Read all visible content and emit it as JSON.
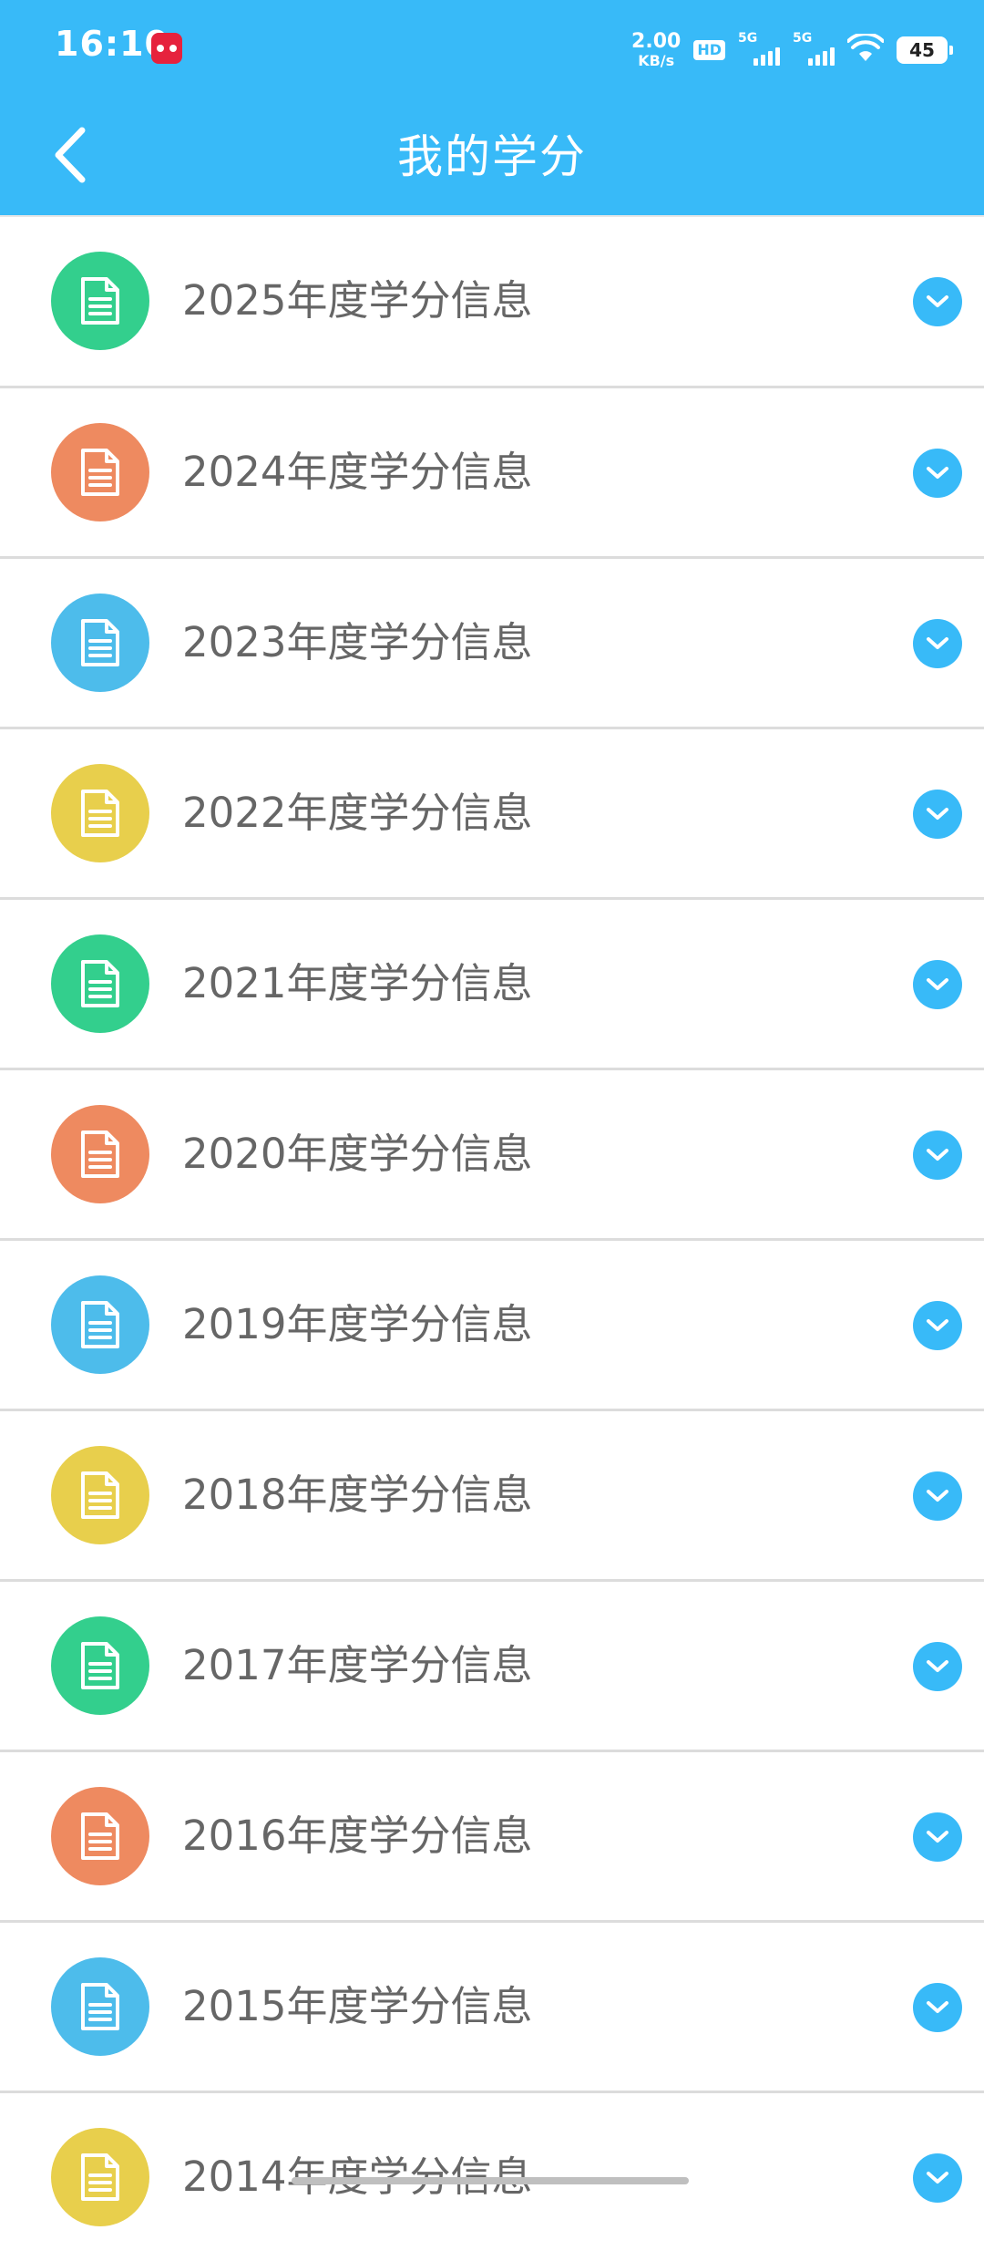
{
  "status_bar": {
    "time": "16:10",
    "net_speed_value": "2.00",
    "net_speed_unit": "KB/s",
    "hd_label": "HD",
    "sim1_label": "5G",
    "sim2_label": "5G",
    "battery": "45"
  },
  "header": {
    "title": "我的学分",
    "back_icon": "chevron-left-icon"
  },
  "colors": {
    "header_bg": "#38BAF8",
    "green": "#33CF8D",
    "orange": "#EE8A60",
    "blue": "#4DBCEB",
    "yellow": "#E8CF4C"
  },
  "list": {
    "items": [
      {
        "label": "2025年度学分信息",
        "color": "green"
      },
      {
        "label": "2024年度学分信息",
        "color": "orange"
      },
      {
        "label": "2023年度学分信息",
        "color": "blue"
      },
      {
        "label": "2022年度学分信息",
        "color": "yellow"
      },
      {
        "label": "2021年度学分信息",
        "color": "green"
      },
      {
        "label": "2020年度学分信息",
        "color": "orange"
      },
      {
        "label": "2019年度学分信息",
        "color": "blue"
      },
      {
        "label": "2018年度学分信息",
        "color": "yellow"
      },
      {
        "label": "2017年度学分信息",
        "color": "green"
      },
      {
        "label": "2016年度学分信息",
        "color": "orange"
      },
      {
        "label": "2015年度学分信息",
        "color": "blue"
      },
      {
        "label": "2014年度学分信息",
        "color": "yellow"
      }
    ]
  }
}
